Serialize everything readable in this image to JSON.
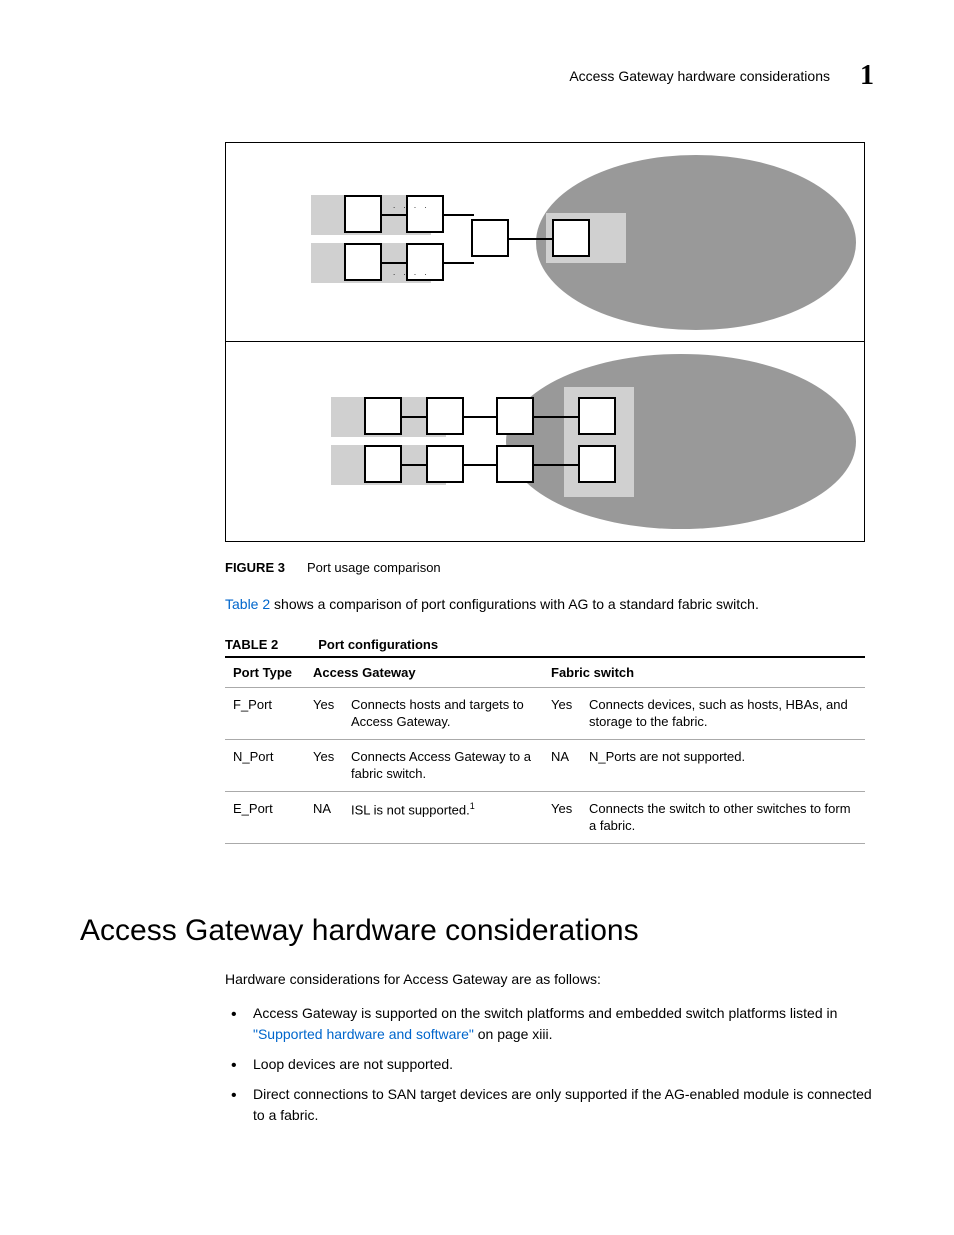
{
  "header": {
    "running_head": "Access Gateway hardware considerations",
    "chapter": "1"
  },
  "figure": {
    "label": "FIGURE 3",
    "caption": "Port usage comparison"
  },
  "para1_prefix": "Table 2",
  "para1_rest": " shows a comparison of port configurations with AG to a standard fabric switch.",
  "table": {
    "label": "TABLE 2",
    "caption": "Port configurations",
    "headers": {
      "port_type": "Port Type",
      "ag": "Access Gateway",
      "fs": "Fabric switch"
    },
    "rows": [
      {
        "pt": "F_Port",
        "ag_yn": "Yes",
        "ag_desc": "Connects hosts and targets to Access Gateway.",
        "fs_yn": "Yes",
        "fs_desc": "Connects devices, such as hosts, HBAs, and storage to the fabric."
      },
      {
        "pt": "N_Port",
        "ag_yn": "Yes",
        "ag_desc": "Connects Access Gateway to a fabric switch.",
        "fs_yn": "NA",
        "fs_desc": "N_Ports are not supported."
      },
      {
        "pt": "E_Port",
        "ag_yn": "NA",
        "ag_desc": "ISL is not supported.",
        "ag_sup": "1",
        "fs_yn": "Yes",
        "fs_desc": "Connects the switch to other switches to form a fabric."
      }
    ]
  },
  "section_heading": "Access Gateway hardware considerations",
  "intro": "Hardware considerations for Access Gateway are as follows:",
  "bullets": [
    {
      "pre": "Access Gateway is supported on the switch platforms and embedded switch platforms listed in ",
      "link": "\"Supported hardware and software\"",
      "post": " on page xiii."
    },
    {
      "text": "Loop devices are not supported."
    },
    {
      "text": "Direct connections to SAN target devices are only supported if the AG-enabled module is connected to a fabric."
    }
  ]
}
